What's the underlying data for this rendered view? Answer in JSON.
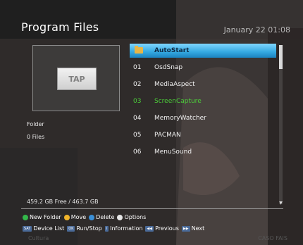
{
  "header": {
    "title": "Program Files",
    "datetime": "January 22 01:08"
  },
  "preview": {
    "tap_label": "TAP",
    "type_label": "Folder",
    "files_label": "0 Files"
  },
  "list": {
    "items": [
      {
        "num": "",
        "name": "AutoStart",
        "state": "selected",
        "icon": "folder-icon"
      },
      {
        "num": "01",
        "name": "OsdSnap",
        "state": "normal"
      },
      {
        "num": "02",
        "name": "MediaAspect",
        "state": "normal"
      },
      {
        "num": "03",
        "name": "ScreenCapture",
        "state": "green"
      },
      {
        "num": "04",
        "name": "MemoryWatcher",
        "state": "normal"
      },
      {
        "num": "05",
        "name": "PACMAN",
        "state": "normal"
      },
      {
        "num": "06",
        "name": "MenuSound",
        "state": "normal"
      }
    ]
  },
  "storage": {
    "text": "459.2 GB Free / 463.7 GB"
  },
  "legend": {
    "new_folder": "New Folder",
    "move": "Move",
    "delete": "Delete",
    "options": "Options",
    "colors": {
      "green": "#33b74a",
      "yellow": "#f0b42a",
      "blue": "#3a8fd7",
      "white": "#e6e6e6"
    }
  },
  "keys": {
    "sat": {
      "cap": "SAT",
      "label": "Device List"
    },
    "ok": {
      "cap": "OK",
      "label": "Run/Stop"
    },
    "info": {
      "cap": "i",
      "label": "Information"
    },
    "prev": {
      "cap": "◀◀",
      "label": "Previous"
    },
    "next": {
      "cap": "▶▶",
      "label": "Next"
    }
  },
  "bottom_logos": {
    "left": "Cultura",
    "right": "CASO FAIS"
  }
}
